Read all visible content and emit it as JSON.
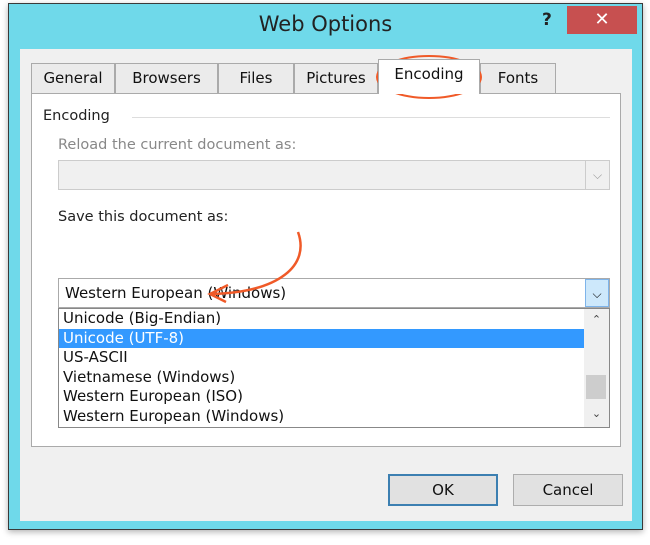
{
  "window": {
    "title": "Web Options",
    "help": "?",
    "close": "✕"
  },
  "tabs": [
    "General",
    "Browsers",
    "Files",
    "Pictures",
    "Encoding",
    "Fonts"
  ],
  "encoding": {
    "group_label": "Encoding",
    "reload_label": "Reload the current document as:",
    "reload_value": "",
    "save_label": "Save this document as:",
    "save_value": "Western European (Windows)",
    "options": [
      "Unicode (Big-Endian)",
      "Unicode (UTF-8)",
      "US-ASCII",
      "Vietnamese (Windows)",
      "Western European (ISO)",
      "Western European (Windows)"
    ],
    "highlighted": "Unicode (UTF-8)"
  },
  "buttons": {
    "ok": "OK",
    "cancel": "Cancel"
  },
  "colors": {
    "titlebar": "#6fd9ea",
    "close": "#c75050",
    "selection": "#3399ff",
    "annotation": "#f05a28"
  }
}
